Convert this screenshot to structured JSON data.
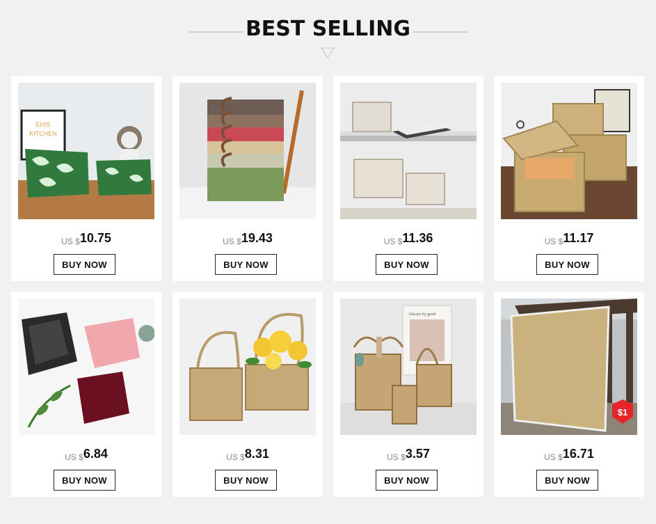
{
  "section": {
    "title": "BEST SELLING"
  },
  "products": [
    {
      "currency": "US $",
      "price": "10.75",
      "button": "BUY NOW",
      "image_badge": "",
      "image_text": [
        "EHIS",
        "KITCHEN"
      ]
    },
    {
      "currency": "US $",
      "price": "19.43",
      "button": "BUY NOW",
      "image_badge": "",
      "image_text": []
    },
    {
      "currency": "US $",
      "price": "11.36",
      "button": "BUY NOW",
      "image_badge": "",
      "image_text": []
    },
    {
      "currency": "US $",
      "price": "11.17",
      "button": "BUY NOW",
      "image_badge": "",
      "image_text": []
    },
    {
      "currency": "US $",
      "price": "6.84",
      "button": "BUY NOW",
      "image_badge": "",
      "image_text": []
    },
    {
      "currency": "US $",
      "price": "8.31",
      "button": "BUY NOW",
      "image_badge": "",
      "image_text": []
    },
    {
      "currency": "US $",
      "price": "3.57",
      "button": "BUY NOW",
      "image_badge": "",
      "image_text": [
        "Always by good"
      ]
    },
    {
      "currency": "US $",
      "price": "16.71",
      "button": "BUY NOW",
      "image_badge": "$1",
      "image_text": []
    }
  ]
}
